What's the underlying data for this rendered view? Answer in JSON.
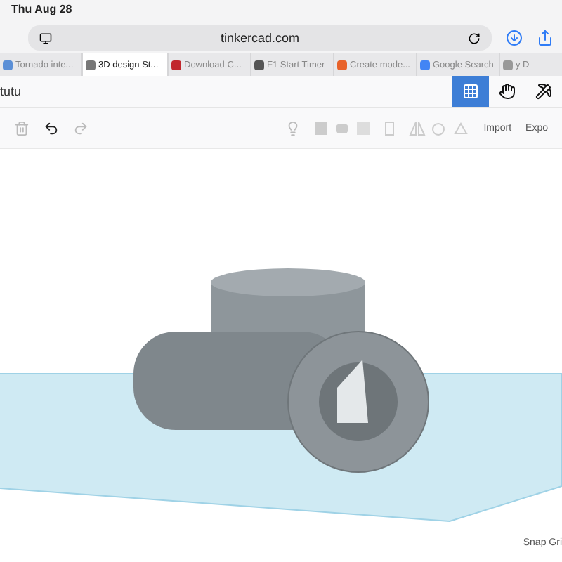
{
  "status_bar": {
    "date": "Thu Aug 28"
  },
  "address_bar": {
    "url": "tinkercad.com"
  },
  "tabs": [
    {
      "label": "Tornado inte...",
      "selected": false
    },
    {
      "label": "3D design St...",
      "selected": true
    },
    {
      "label": "Download C...",
      "selected": false
    },
    {
      "label": "F1 Start Timer",
      "selected": false
    },
    {
      "label": "Create mode...",
      "selected": false
    },
    {
      "label": "Google Search",
      "selected": false
    },
    {
      "label": "y D",
      "selected": false
    }
  ],
  "header": {
    "title": "tutu",
    "view_buttons": [
      {
        "selected": true
      },
      {
        "selected": false
      },
      {
        "selected": false
      }
    ]
  },
  "toolbar": {
    "buttons": [
      "Import",
      "Expo"
    ]
  },
  "canvas": {
    "snap_grid": "Snap Gri"
  }
}
